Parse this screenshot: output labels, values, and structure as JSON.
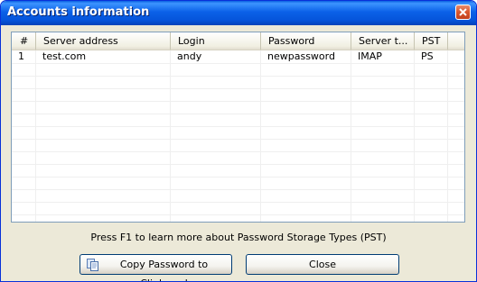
{
  "window": {
    "title": "Accounts information"
  },
  "table": {
    "columns": [
      "#",
      "Server address",
      "Login",
      "Password",
      "Server t...",
      "PST"
    ],
    "rows": [
      [
        "1",
        "test.com",
        "andy",
        "newpassword",
        "IMAP",
        "PS"
      ]
    ]
  },
  "info_text": "Press F1 to learn more about Password Storage Types (PST)",
  "buttons": {
    "copy_label": "Copy Password to Clipboard",
    "close_label": "Close"
  },
  "icons": {
    "close": "close-icon",
    "copy": "clipboard-icon"
  }
}
